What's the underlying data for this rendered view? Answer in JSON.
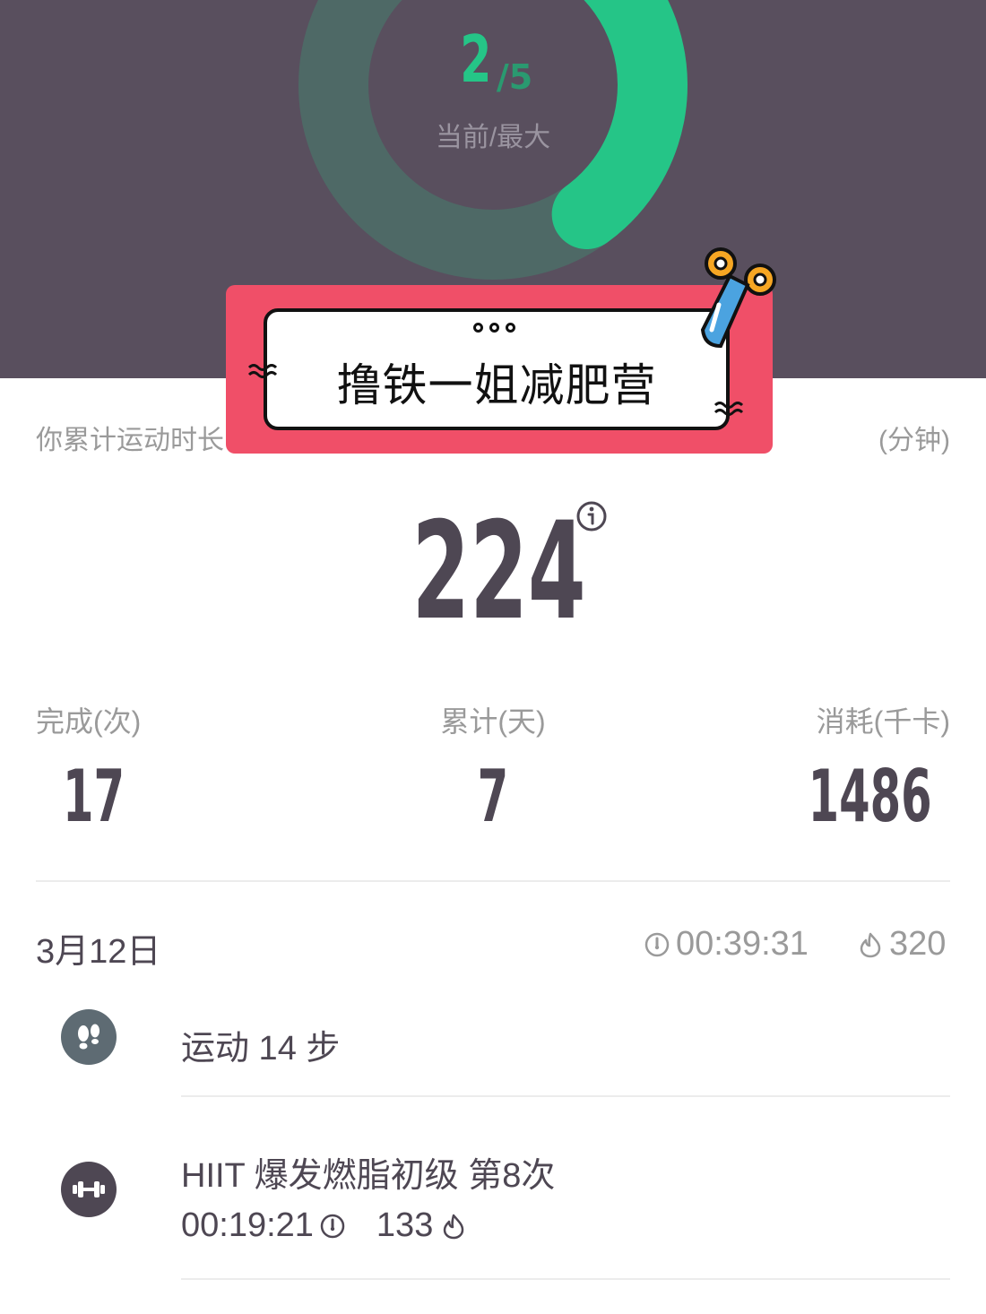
{
  "header": {
    "progress_current": "2",
    "progress_sep": "/",
    "progress_max": "5",
    "progress_fraction": 0.4,
    "progress_caption": "当前/最大",
    "ring_color": "#25c587",
    "track_color": "#4e6966",
    "background": "#594f5e"
  },
  "sticker": {
    "title": "撸铁一姐减肥营",
    "icon": "scissors-icon",
    "color": "#f04f68"
  },
  "summary": {
    "total_label": "你累计运动时长",
    "total_unit": "(分钟)",
    "total_value": "224",
    "info_icon": "info-icon"
  },
  "stats": [
    {
      "label": "完成(次)",
      "value": "17"
    },
    {
      "label": "累计(天)",
      "value": "7"
    },
    {
      "label": "消耗(千卡)",
      "value": "1486"
    }
  ],
  "day": {
    "date": "3月12日",
    "duration": "00:39:31",
    "calories": "320",
    "duration_icon": "timer-icon",
    "calories_icon": "flame-icon"
  },
  "activities": [
    {
      "icon": "footsteps-icon",
      "title": "运动 14 步"
    },
    {
      "icon": "dumbbell-icon",
      "title": "HIIT 爆发燃脂初级 第8次",
      "duration": "00:19:21",
      "calories": "133"
    }
  ]
}
